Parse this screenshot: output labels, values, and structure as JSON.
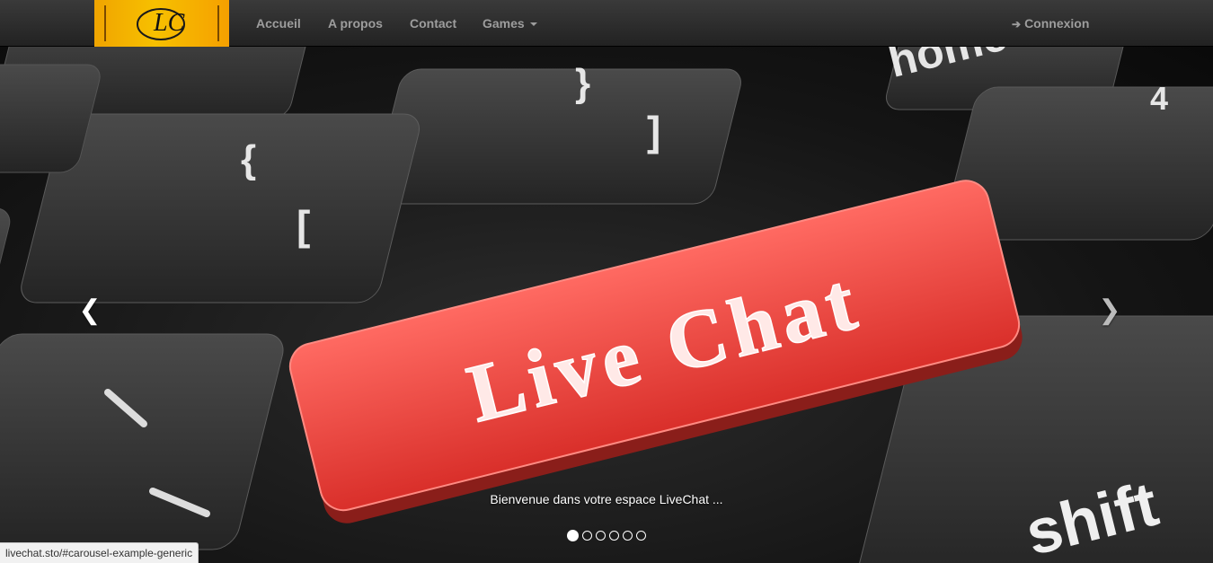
{
  "navbar": {
    "logo_text": "LC",
    "links": [
      {
        "label": "Accueil"
      },
      {
        "label": "A propos"
      },
      {
        "label": "Contact"
      },
      {
        "label": "Games"
      }
    ],
    "login_label": "Connexion",
    "login_icon": "sign-in-icon"
  },
  "carousel": {
    "slide_text": "Live Chat",
    "key_labels": [
      "{",
      "[",
      "}",
      "]",
      "4",
      "shift",
      "home"
    ],
    "caption": "Bienvenue dans votre espace LiveChat ...",
    "prev_icon": "chevron-left-icon",
    "next_icon": "chevron-right-icon",
    "indicator_count": 6,
    "active_indicator": 0,
    "accent_color": "#e8413c"
  },
  "statusbar": {
    "url": "livechat.sto/#carousel-example-generic"
  }
}
